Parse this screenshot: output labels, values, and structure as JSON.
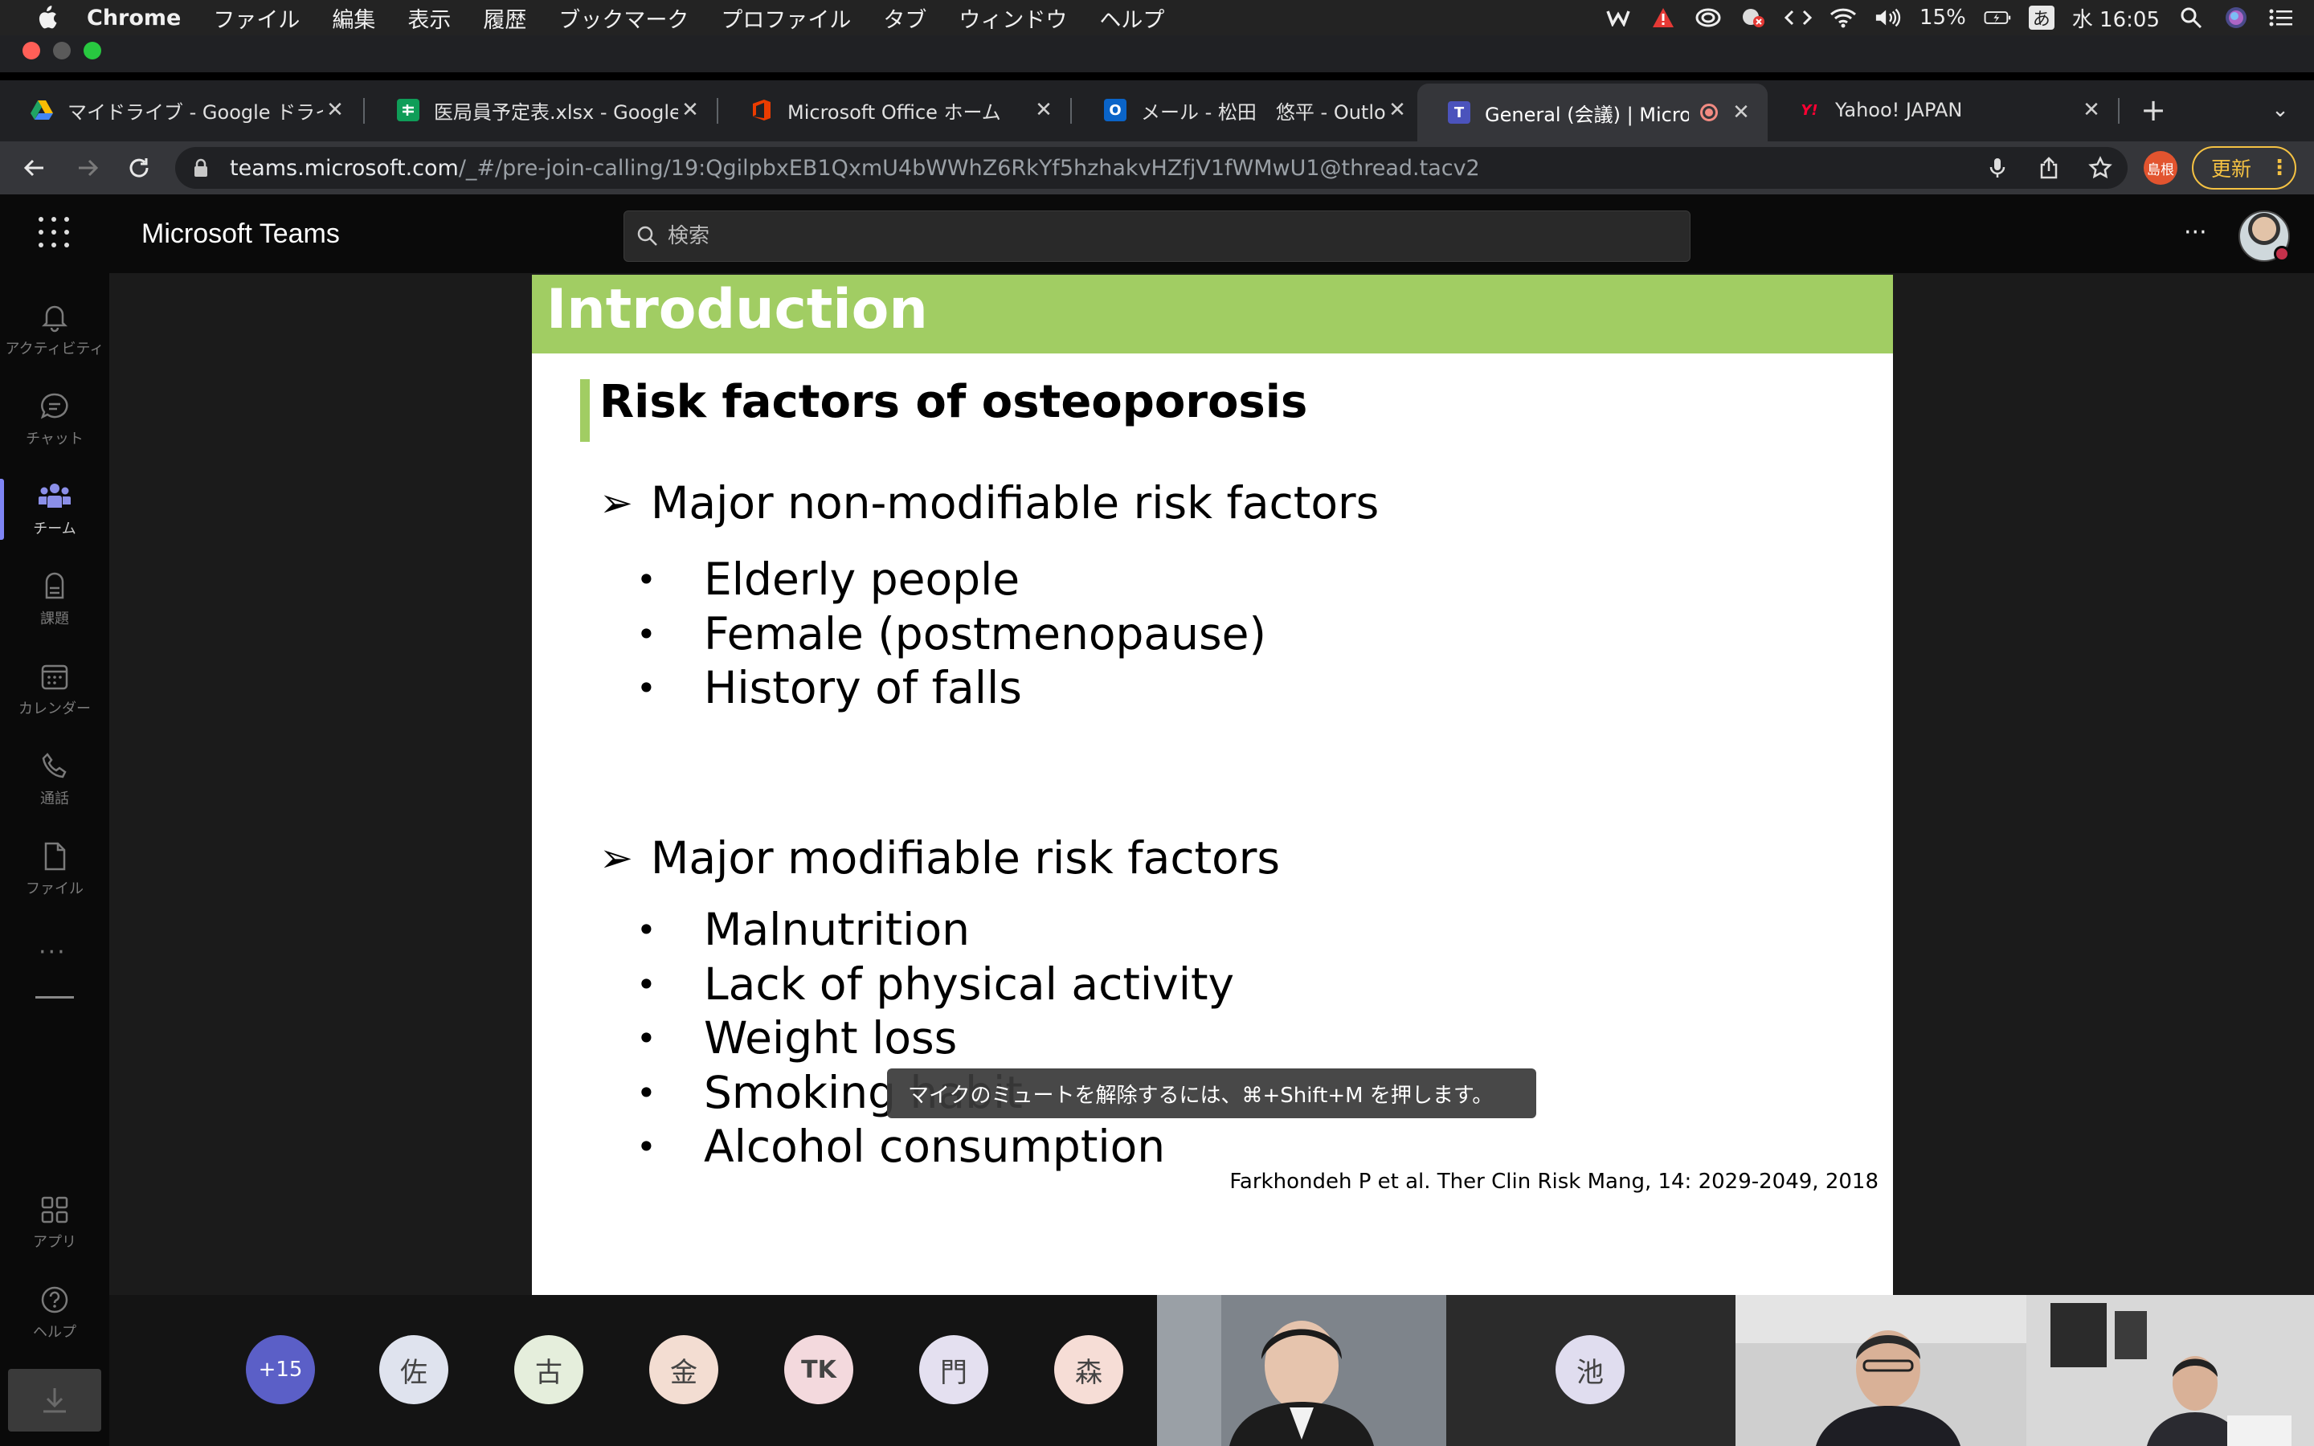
{
  "menubar": {
    "app": "Chrome",
    "items": [
      "ファイル",
      "編集",
      "表示",
      "履歴",
      "ブックマーク",
      "プロファイル",
      "タブ",
      "ウィンドウ",
      "ヘルプ"
    ],
    "battery": "15%",
    "ime": "あ",
    "clock": "水 16:05"
  },
  "tabs": [
    {
      "title": "マイドライブ - Google ドライブ",
      "favicon": "google-drive-icon"
    },
    {
      "title": "医局員予定表.xlsx - Google スプレッドシート",
      "favicon": "google-sheets-icon"
    },
    {
      "title": "Microsoft Office ホーム",
      "favicon": "office-icon"
    },
    {
      "title": "メール - 松田　悠平 - Outlook",
      "favicon": "outlook-icon"
    },
    {
      "title": "General (会議) | Microsoft Teams",
      "favicon": "teams-icon",
      "active": true
    },
    {
      "title": "Yahoo! JAPAN",
      "favicon": "yahoo-icon"
    }
  ],
  "address": {
    "host": "teams.microsoft.com",
    "path": "/_#/pre-join-calling/19:QgilpbxEB1QxmU4bWWhZ6RkYf5hzhakvHZfjV1fWMwU1@thread.tacv2"
  },
  "profile_chip": "島根",
  "update_label": "更新",
  "teams": {
    "title": "Microsoft Teams",
    "search_placeholder": "検索"
  },
  "rail": [
    {
      "label": "アクティビティ",
      "icon": "bell-icon"
    },
    {
      "label": "チャット",
      "icon": "chat-icon"
    },
    {
      "label": "チーム",
      "icon": "teams-people-icon",
      "active": true
    },
    {
      "label": "課題",
      "icon": "assignments-icon"
    },
    {
      "label": "カレンダー",
      "icon": "calendar-icon"
    },
    {
      "label": "通話",
      "icon": "phone-icon"
    },
    {
      "label": "ファイル",
      "icon": "file-icon"
    }
  ],
  "rail_bottom": [
    {
      "label": "アプリ",
      "icon": "apps-icon"
    },
    {
      "label": "ヘルプ",
      "icon": "help-icon"
    }
  ],
  "slide": {
    "title": "Introduction",
    "subtitle": "Risk factors of osteoporosis",
    "sections": [
      {
        "heading": "Major non-modifiable risk factors",
        "items": [
          "Elderly people",
          "Female (postmenopause)",
          "History of falls"
        ]
      },
      {
        "heading": "Major modifiable risk factors",
        "items": [
          "Malnutrition",
          "Lack of physical activity",
          "Weight loss",
          "Smoking habit",
          "Alcohol consumption"
        ]
      }
    ],
    "citation": "Farkhondeh P et al. Ther Clin Risk Mang, 14: 2029-2049, 2018"
  },
  "tooltip": "マイクのミュートを解除するには、⌘+Shift+M を押します。",
  "participants": [
    {
      "initials": "+15",
      "color": "#5b5fc7"
    },
    {
      "initials": "佐",
      "color": "#dfe3ee"
    },
    {
      "initials": "古",
      "color": "#e5eedc"
    },
    {
      "initials": "金",
      "color": "#f3ddd2"
    },
    {
      "initials": "TK",
      "color": "#f3d9dd"
    },
    {
      "initials": "門",
      "color": "#e4e0f0"
    },
    {
      "initials": "森",
      "color": "#f6ddd6"
    },
    {
      "initials": "池",
      "color": "#e0ddef"
    }
  ]
}
